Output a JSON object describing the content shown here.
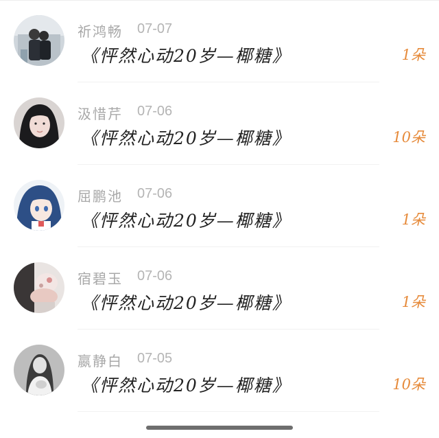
{
  "items": [
    {
      "name": "祈鸿畅",
      "date": "07-07",
      "title": "《怦然心动20岁—椰糖》",
      "count": "1朵",
      "avatar": "photo-avatar-couple"
    },
    {
      "name": "汲惜芹",
      "date": "07-06",
      "title": "《怦然心动20岁—椰糖》",
      "count": "10朵",
      "avatar": "photo-avatar-girl"
    },
    {
      "name": "屈鹏池",
      "date": "07-06",
      "title": "《怦然心动20岁—椰糖》",
      "count": "1朵",
      "avatar": "anime-avatar"
    },
    {
      "name": "宿碧玉",
      "date": "07-06",
      "title": "《怦然心动20岁—椰糖》",
      "count": "1朵",
      "avatar": "photo-avatar-hands"
    },
    {
      "name": "嬴静白",
      "date": "07-05",
      "title": "《怦然心动20岁—椰糖》",
      "count": "10朵",
      "avatar": "photo-avatar-bw"
    }
  ],
  "colors": {
    "count": "#e68a3a",
    "name": "#a8a8a8",
    "title": "#222222"
  }
}
